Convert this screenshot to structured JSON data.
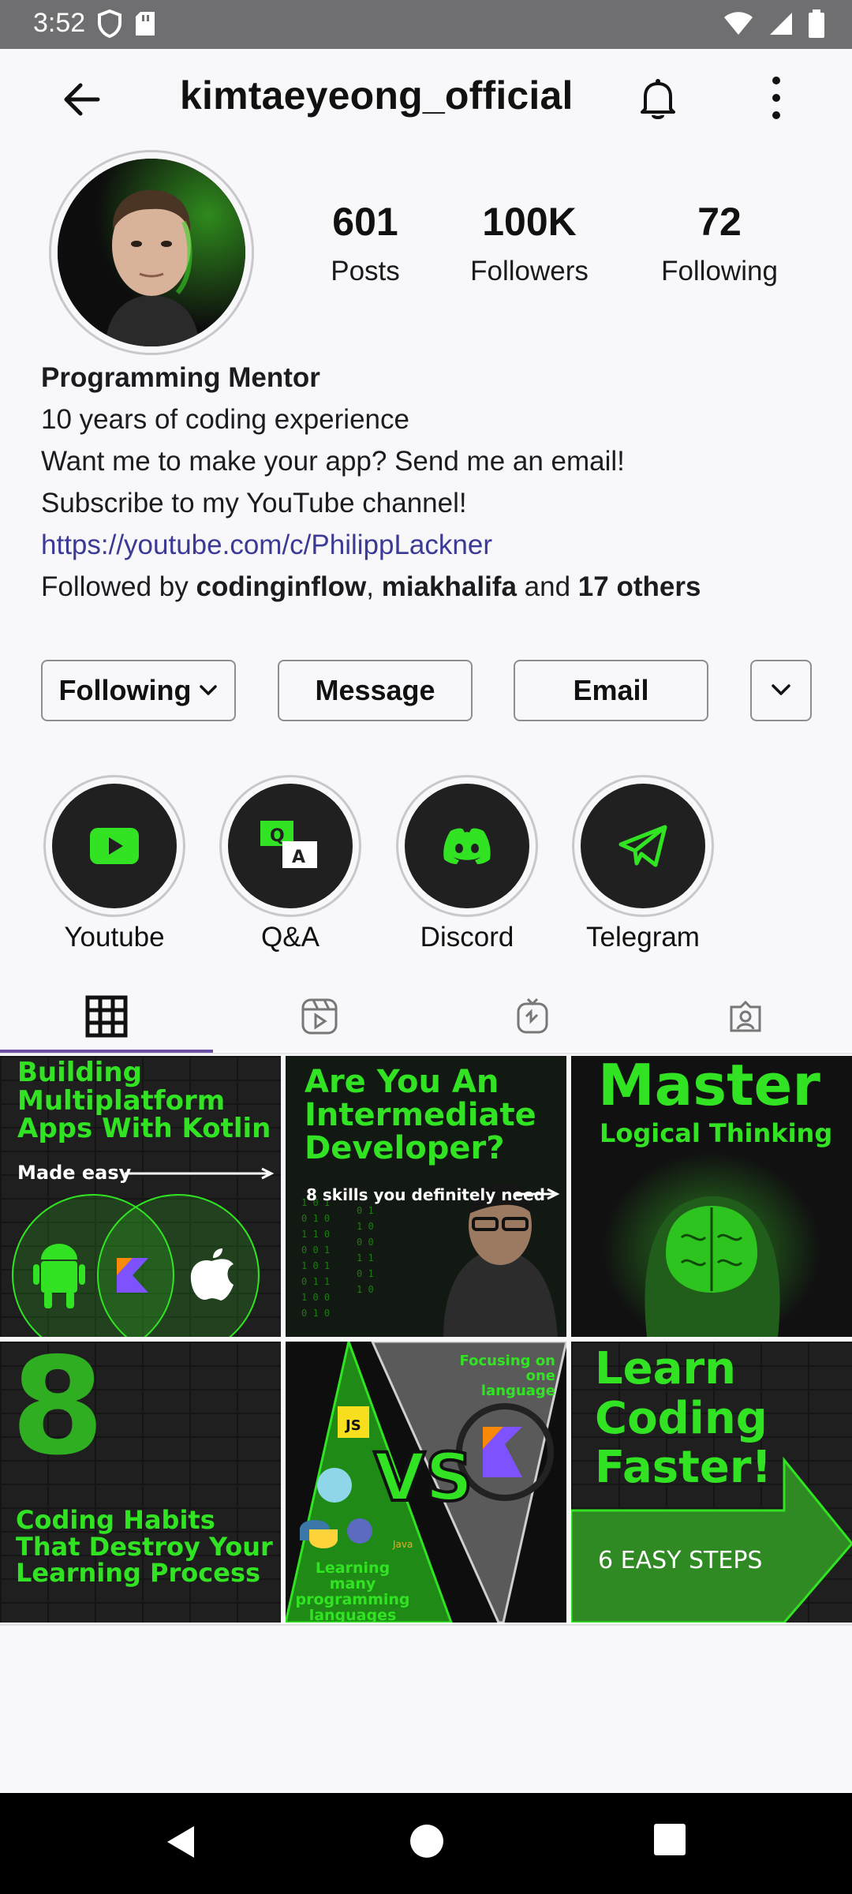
{
  "status_bar": {
    "time": "3:52"
  },
  "topbar": {
    "username": "kimtaeyeong_official"
  },
  "stats": {
    "posts_count": "601",
    "posts_label": "Posts",
    "followers_count": "100K",
    "followers_label": "Followers",
    "following_count": "72",
    "following_label": "Following"
  },
  "bio": {
    "name": "Programming Mentor",
    "line1": "10 years of coding experience",
    "line2": "Want me to make your app? Send me an email!",
    "line3": "Subscribe to my YouTube channel!",
    "link": "https://youtube.com/c/PhilippLackner",
    "followed_by_prefix": "Followed by ",
    "followed_user1": "codinginflow",
    "separator": ", ",
    "followed_user2": "miakhalifa",
    "and_text": " and ",
    "others": "17 others"
  },
  "buttons": {
    "following": "Following",
    "message": "Message",
    "email": "Email"
  },
  "highlights": [
    {
      "label": "Youtube"
    },
    {
      "label": "Q&A"
    },
    {
      "label": "Discord"
    },
    {
      "label": "Telegram"
    }
  ],
  "posts": {
    "p1": {
      "title": "Building Multiplatform Apps With Kotlin",
      "sub": "Made easy"
    },
    "p2": {
      "title": "Are You An Intermediate Developer?",
      "sub": "8 skills you definitely need"
    },
    "p3": {
      "title": "Master",
      "sub": "Logical Thinking"
    },
    "p4": {
      "number": "8",
      "title": "Coding Habits That Destroy Your Learning Process"
    },
    "p5": {
      "top": "Focusing on one language",
      "vs": "VS",
      "bottom": "Learning many programming languages",
      "js": "JS",
      "java": "Java"
    },
    "p6": {
      "title": "Learn Coding Faster!",
      "sub": "6 EASY STEPS"
    }
  },
  "colors": {
    "accent_green": "#31e323",
    "tab_indicator": "#6b4fa5",
    "link": "#3b3a94"
  }
}
